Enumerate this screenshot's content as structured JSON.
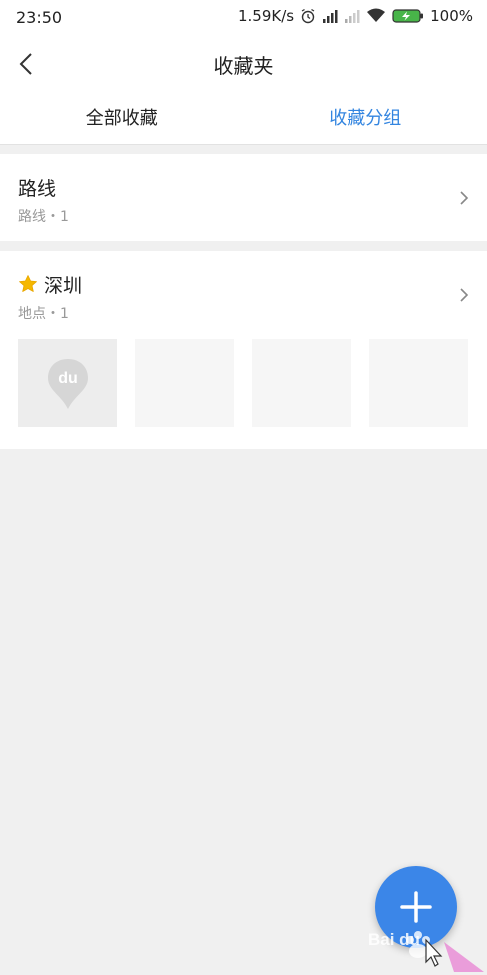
{
  "status_bar": {
    "time": "23:50",
    "network_speed": "1.59K/s",
    "battery": "100%",
    "icons": [
      "alarm-icon",
      "signal-icon",
      "signal-weak-icon",
      "wifi-icon",
      "battery-charging-icon"
    ]
  },
  "header": {
    "title": "收藏夹",
    "back_icon": "back-arrow-icon"
  },
  "tabs": [
    {
      "label": "全部收藏",
      "active": false
    },
    {
      "label": "收藏分组",
      "active": true
    }
  ],
  "groups": [
    {
      "title": "路线",
      "subtitle": "路线・1"
    },
    {
      "title": "深圳",
      "subtitle": "地点・1",
      "icon": "star-icon"
    }
  ],
  "fab": {
    "icon": "plus-icon"
  },
  "watermark": {
    "text": "Bai du"
  },
  "colors": {
    "accent": "#3385e0",
    "fab": "#3b86e8",
    "star": "#f5b800",
    "background": "#f0f0f0"
  }
}
